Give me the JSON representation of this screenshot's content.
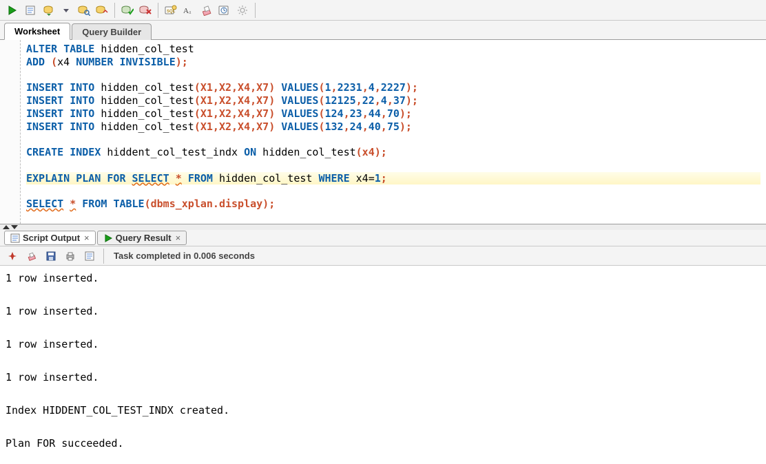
{
  "toolbar": {
    "icons": [
      "run-icon",
      "run-script-icon",
      "explain-plan-icon",
      "dropdown-icon",
      "autotrace-icon",
      "sql-tuning-icon",
      "sep",
      "commit-icon",
      "rollback-icon",
      "sep",
      "unshared-sql-icon",
      "to-upper-icon",
      "clear-icon",
      "sql-history-icon",
      "settings-icon",
      "sep"
    ]
  },
  "tabs": {
    "worksheet": "Worksheet",
    "queryBuilder": "Query Builder"
  },
  "code": {
    "l1a": "ALTER",
    "l1b": "TABLE",
    "l1c": " hidden_col_test",
    "l2a": "ADD",
    "l2b": " (",
    "l2c": "x4 ",
    "l2d": "NUMBER",
    "l2e": "INVISIBLE",
    "l2f": ");",
    "ins": "INSERT",
    "into": "INTO",
    "tgt": " hidden_col_test",
    "cols": "(X1,X2,X4,X7)",
    "vals": "VALUES",
    "v1": "(1,2231,4,2227)",
    "v2": "(12125,22,4,37)",
    "v3": "(124,23,44,70)",
    "v4": "(132,24,40,75)",
    "cr": "CREATE",
    "idx": "INDEX",
    "idxn": " hiddent_col_test_indx ",
    "on": "ON",
    "idxt": " hidden_col_test",
    "idxc": "(x4)",
    "exp": "EXPLAIN",
    "plan": "PLAN",
    "for": "FOR",
    "sel": "SELECT",
    "star": "*",
    "from": "FROM",
    "ht": " hidden_col_test ",
    "where": "WHERE",
    "pred": " x4=",
    "one": "1",
    "sel2": "SELECT",
    "star2": "*",
    "from2": "FROM",
    "tbl": "TABLE",
    "disp": "(dbms_xplan.display)",
    "semi": ";",
    " ": " "
  },
  "lowerTabs": {
    "scriptOutput": "Script Output",
    "queryResult": "Query Result"
  },
  "status": {
    "text": "Task completed in 0.006 seconds"
  },
  "output": {
    "lines": [
      "1 row inserted.",
      "",
      "1 row inserted.",
      "",
      "1 row inserted.",
      "",
      "1 row inserted.",
      "",
      "Index HIDDENT_COL_TEST_INDX created.",
      "",
      "Plan FOR succeeded."
    ]
  }
}
